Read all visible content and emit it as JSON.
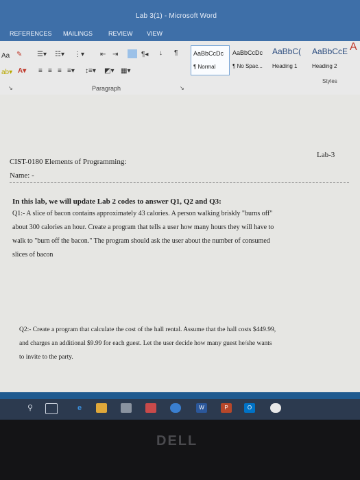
{
  "window": {
    "title": "Lab 3(1) - Microsoft Word"
  },
  "ribbon_tabs": [
    "REFERENCES",
    "MAILINGS",
    "REVIEW",
    "VIEW"
  ],
  "ribbon": {
    "font_size_label": "Aa",
    "paragraph_label": "Paragraph",
    "styles_label": "Styles",
    "styles": [
      {
        "sample": "AaBbCcDc",
        "name": "¶ Normal"
      },
      {
        "sample": "AaBbCcDc",
        "name": "¶ No Spac..."
      },
      {
        "sample": "AaBbC(",
        "name": "Heading 1"
      },
      {
        "sample": "AaBbCcE",
        "name": "Heading 2"
      }
    ]
  },
  "document": {
    "lab_number": "Lab-3",
    "course": "CIST-0180 Elements of Programming:",
    "name_label": "Name: -",
    "intro": "In this lab, we will update Lab 2 codes to answer Q1, Q2 and Q3:",
    "q1_lines": [
      "Q1:- A slice of bacon contains approximately 43 calories. A person walking briskly \"burns off\"",
      "about 300 calories an hour. Create a program that tells a user how many hours they will have to",
      "walk to \"burn off the bacon.\" The program should ask the user about the number of consumed",
      "slices of bacon"
    ],
    "q2_lines": [
      "Q2:- Create a program that calculate the cost of the hall rental. Assume that the hall costs $449.99,",
      "and charges an additional $9.99 for each guest. Let the user decide how many guest he/she wants",
      "to invite to the party."
    ]
  },
  "brand": "DELL",
  "colors": {
    "titlebar": "#3e6fa8",
    "ribbon": "#e9e9e9",
    "document": "#e6e6e3",
    "taskbar": "#2c3a4f"
  }
}
